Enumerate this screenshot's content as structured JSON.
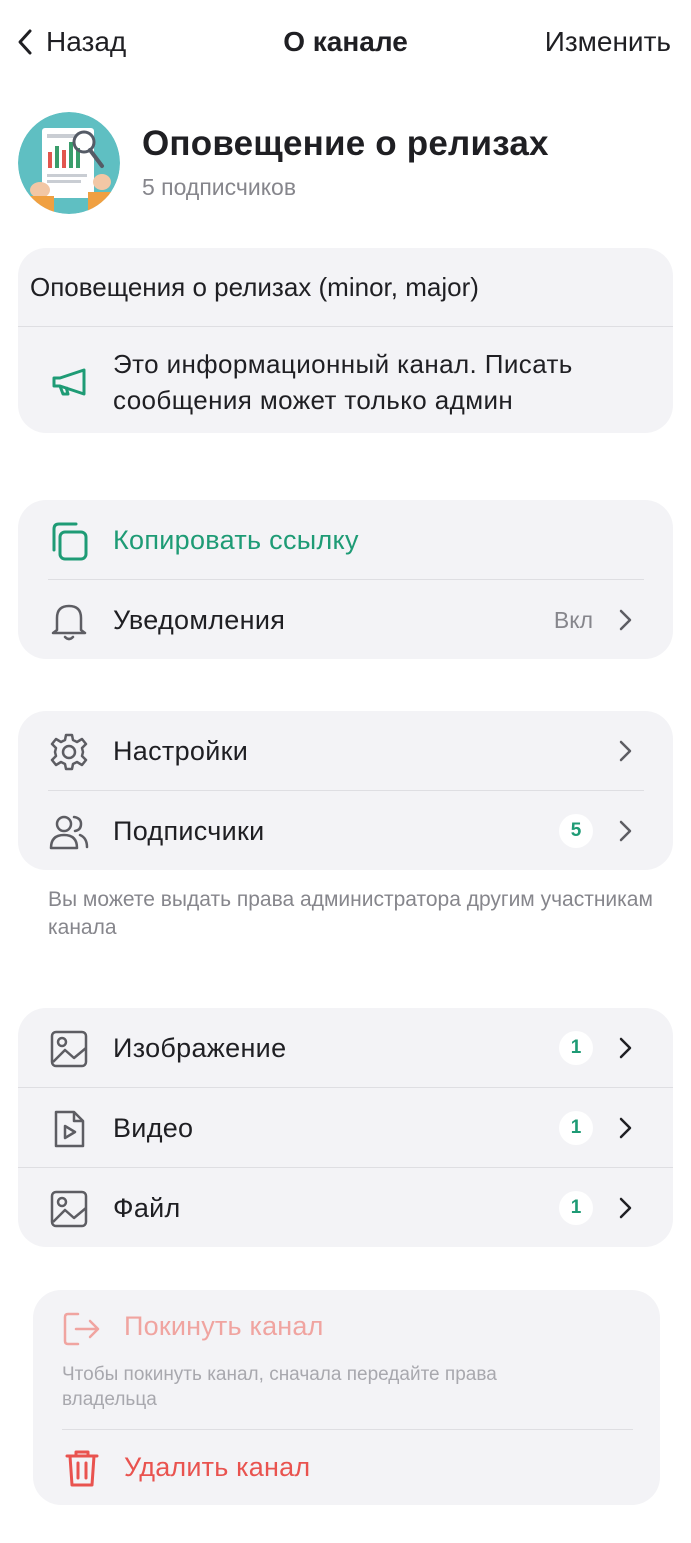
{
  "header": {
    "back_label": "Назад",
    "title": "О канале",
    "edit_label": "Изменить"
  },
  "channel": {
    "name": "Оповещение о релизах",
    "subscribers": "5 подписчиков",
    "description": "Оповещения о релизах (minor, major)",
    "info_text": "Это информационный канал. Писать сообщения может только админ"
  },
  "actions": {
    "copy_link": "Копировать ссылку",
    "notifications": {
      "label": "Уведомления",
      "value": "Вкл"
    }
  },
  "manage": {
    "settings": "Настройки",
    "subscribers": {
      "label": "Подписчики",
      "count": "5"
    },
    "hint": "Вы можете выдать права администратора другим участникам канала"
  },
  "media": {
    "items": [
      {
        "label": "Изображение",
        "count": "1",
        "icon": "image-icon"
      },
      {
        "label": "Видео",
        "count": "1",
        "icon": "video-file-icon"
      },
      {
        "label": "Файл",
        "count": "1",
        "icon": "image-icon"
      }
    ]
  },
  "danger": {
    "leave_label": "Покинуть канал",
    "leave_hint": "Чтобы покинуть канал, сначала передайте права владельца",
    "delete_label": "Удалить канал"
  },
  "colors": {
    "accent": "#1e9b75",
    "danger": "#e9534f",
    "danger_disabled": "#f0a4a0",
    "card_bg": "#f3f3f6"
  }
}
